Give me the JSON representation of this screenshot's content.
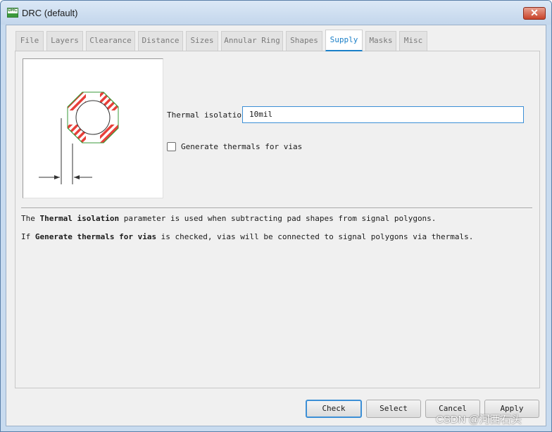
{
  "window": {
    "title": "DRC (default)",
    "icon_text": "DRC",
    "close_glyph": "✕",
    "accent": "#1a7fc8"
  },
  "tabs": [
    {
      "label": "File",
      "active": false
    },
    {
      "label": "Layers",
      "active": false
    },
    {
      "label": "Clearance",
      "active": false
    },
    {
      "label": "Distance",
      "active": false
    },
    {
      "label": "Sizes",
      "active": false
    },
    {
      "label": "Annular Ring",
      "active": false
    },
    {
      "label": "Shapes",
      "active": false
    },
    {
      "label": "Supply",
      "active": true
    },
    {
      "label": "Masks",
      "active": false
    },
    {
      "label": "Misc",
      "active": false
    }
  ],
  "supply": {
    "thermal_isolation_label": "Thermal isolation",
    "thermal_isolation_value": "10mil",
    "generate_thermals_label": "Generate thermals for vias",
    "generate_thermals_checked": false
  },
  "description": {
    "line1_prefix": "The ",
    "line1_bold": "Thermal isolation",
    "line1_suffix": " parameter is used when subtracting pad shapes from signal polygons.",
    "line2_prefix": "If ",
    "line2_bold": "Generate thermals for vias",
    "line2_suffix": " is checked, vias will be connected to signal polygons via thermals."
  },
  "buttons": {
    "check": "Check",
    "select": "Select",
    "cancel": "Cancel",
    "apply": "Apply"
  },
  "watermark": "CSDN @河西石头",
  "colors": {
    "thermal_hatch": "#e8403a",
    "polygon_outline": "#3a9a3a"
  }
}
